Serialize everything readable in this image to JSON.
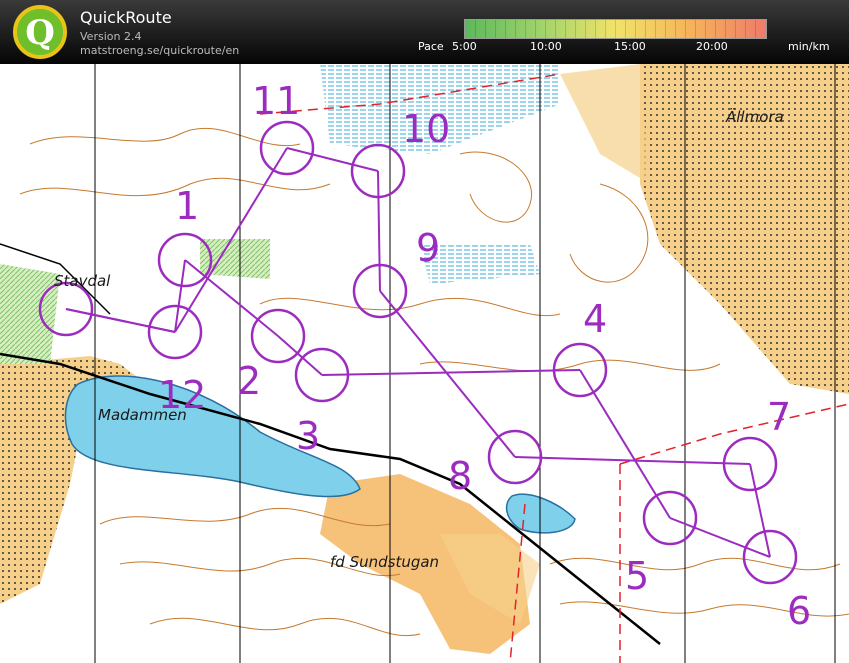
{
  "app": {
    "title": "QuickRoute",
    "version": "Version 2.4",
    "url": "matstroeng.se/quickroute/en",
    "logo_letter": "Q"
  },
  "pace": {
    "label": "Pace",
    "ticks": [
      "5:00",
      "10:00",
      "15:00",
      "20:00"
    ],
    "unit": "min/km"
  },
  "map": {
    "place_names": [
      "Stavdal",
      "Madammen",
      "fd Sundstugan",
      "Ällmora"
    ],
    "control_labels": [
      "1",
      "2",
      "3",
      "4",
      "5",
      "6",
      "7",
      "8",
      "9",
      "10",
      "11",
      "12"
    ],
    "colors": {
      "course": "#9c2bbf",
      "open_land": "#f6d08a",
      "water": "#7fd0ea",
      "forest": "#ffffff",
      "contour": "#c57a2e",
      "magnetic_lines": "#000000"
    }
  }
}
